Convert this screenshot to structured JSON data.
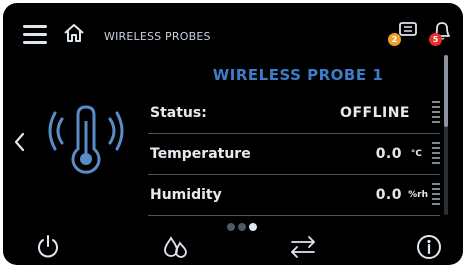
{
  "header": {
    "breadcrumb": "WIRELESS PROBES",
    "messages_badge": "2",
    "alarms_badge": "5"
  },
  "panel": {
    "title": "WIRELESS PROBE 1",
    "rows": [
      {
        "label": "Status:",
        "value": "OFFLINE",
        "unit": ""
      },
      {
        "label": "Temperature",
        "value": "0.0",
        "unit": "°C"
      },
      {
        "label": "Humidity",
        "value": "0.0",
        "unit": "%rh"
      }
    ]
  },
  "pager": {
    "pages": 3,
    "current": 3
  },
  "colors": {
    "accent": "#3d7cc8",
    "badge_orange": "#f0a028",
    "badge_red": "#e8302a",
    "icon": "#dfe6ee",
    "probe_icon": "#5a8cc8"
  },
  "icons": {
    "menu": "hamburger-icon",
    "home": "home-icon",
    "messages": "message-icon",
    "alarms": "bell-icon",
    "prev": "chevron-left-icon",
    "power": "power-icon",
    "mode": "humidity-drops-icon",
    "transfer": "transfer-arrows-icon",
    "info": "info-icon"
  }
}
